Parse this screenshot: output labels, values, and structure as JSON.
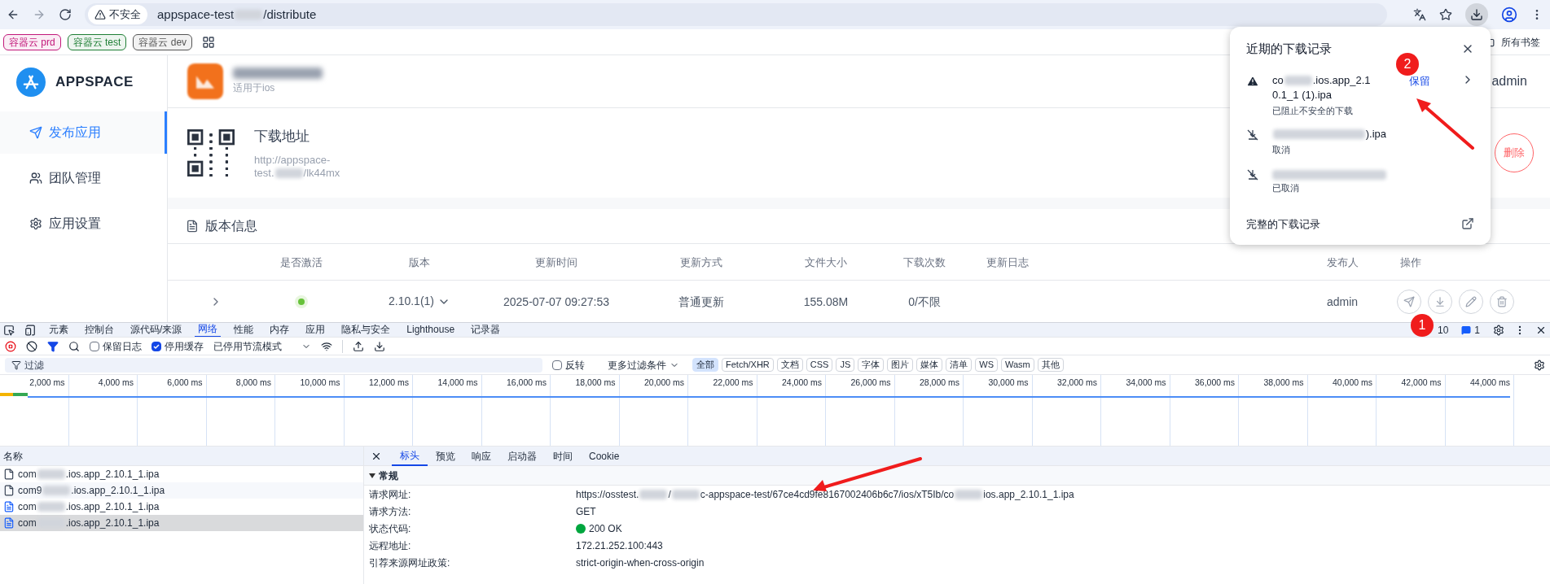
{
  "browser": {
    "security": "不安全",
    "url": [
      "appspace-test",
      "/distribute"
    ]
  },
  "bookmarks": [
    {
      "label": "容器云 prd",
      "color": "#c2187a"
    },
    {
      "label": "容器云 test",
      "color": "#1e7e34"
    },
    {
      "label": "容器云 dev",
      "color": "#555555"
    }
  ],
  "all_bookmarks": "所有书签",
  "sidebar": {
    "logo": "APPSPACE",
    "items": [
      {
        "label": "发布应用",
        "selected": true
      },
      {
        "label": "团队管理",
        "selected": false
      },
      {
        "label": "应用设置",
        "selected": false
      }
    ]
  },
  "app_header": {
    "platform": "适用于ios",
    "user": "admin"
  },
  "download": {
    "title": "下载地址",
    "url_line1": "http://appspace-",
    "url_line2": [
      "test.",
      "/lk44mx"
    ],
    "delete": "删除"
  },
  "versions": {
    "title": "版本信息",
    "columns": [
      "是否激活",
      "版本",
      "更新时间",
      "更新方式",
      "文件大小",
      "下载次数",
      "更新日志",
      "发布人",
      "操作"
    ],
    "rows": [
      {
        "active": true,
        "version": "2.10.1(1)",
        "time": "2025-07-07 09:27:53",
        "method": "普通更新",
        "size": "155.08M",
        "downloads": "0/不限",
        "publisher": "admin"
      }
    ]
  },
  "downloads_popup": {
    "title": "近期的下载记录",
    "items": [
      {
        "kind": "blocked",
        "name": [
          "co",
          ".ios.app_2.1",
          "0.1_1 (1).ipa"
        ],
        "status": "已阻止不安全的下载",
        "action": "保留"
      },
      {
        "kind": "cancelled",
        "redacted_start": true,
        "name": [
          ").ipa"
        ],
        "status": "取消"
      },
      {
        "kind": "cancelled",
        "status": "已取消"
      }
    ],
    "footer": "完整的下载记录"
  },
  "annotations": [
    {
      "label": "1"
    },
    {
      "label": "2"
    }
  ],
  "devtools": {
    "tabs": [
      {
        "label": "元素",
        "selected": false
      },
      {
        "label": "控制台",
        "selected": false
      },
      {
        "label": "源代码/来源",
        "selected": false
      },
      {
        "label": "网络",
        "selected": true
      },
      {
        "label": "性能",
        "selected": false
      },
      {
        "label": "内存",
        "selected": false
      },
      {
        "label": "应用",
        "selected": false
      },
      {
        "label": "隐私与安全",
        "selected": false
      },
      {
        "label": "Lighthouse",
        "selected": false
      },
      {
        "label": "记录器",
        "selected": false
      }
    ],
    "errors": "10",
    "messages": "1",
    "options": [
      {
        "label": "保留日志",
        "checked": false
      },
      {
        "label": "停用缓存",
        "checked": true
      }
    ],
    "throttling": "已停用节流模式",
    "filter_placeholder": "过滤",
    "invert": {
      "label": "反转",
      "checked": false
    },
    "more_filters": "更多过滤条件",
    "chips": [
      {
        "label": "全部",
        "selected": true
      },
      {
        "label": "Fetch/XHR",
        "selected": false
      },
      {
        "label": "文档",
        "selected": false
      },
      {
        "label": "CSS",
        "selected": false
      },
      {
        "label": "JS",
        "selected": false
      },
      {
        "label": "字体",
        "selected": false
      },
      {
        "label": "图片",
        "selected": false
      },
      {
        "label": "媒体",
        "selected": false
      },
      {
        "label": "清单",
        "selected": false
      },
      {
        "label": "WS",
        "selected": false
      },
      {
        "label": "Wasm",
        "selected": false
      },
      {
        "label": "其他",
        "selected": false
      }
    ],
    "ticks": [
      "2,000 ms",
      "4,000 ms",
      "6,000 ms",
      "8,000 ms",
      "10,000 ms",
      "12,000 ms",
      "14,000 ms",
      "16,000 ms",
      "18,000 ms",
      "20,000 ms",
      "22,000 ms",
      "24,000 ms",
      "26,000 ms",
      "28,000 ms",
      "30,000 ms",
      "32,000 ms",
      "34,000 ms",
      "36,000 ms",
      "38,000 ms",
      "40,000 ms",
      "42,000 ms",
      "44,000 ms"
    ],
    "list_header": "名称",
    "requests": [
      {
        "kind": "file",
        "name": [
          "com",
          ".ios.app_2.10.1_1.ipa"
        ],
        "selected": false
      },
      {
        "kind": "file",
        "name": [
          "com9",
          ".ios.app_2.10.1_1.ipa"
        ],
        "selected": false
      },
      {
        "kind": "document",
        "name": [
          "com",
          ".ios.app_2.10.1_1.ipa"
        ],
        "selected": false
      },
      {
        "kind": "document",
        "name": [
          "com",
          ".ios.app_2.10.1_1.ipa"
        ],
        "selected": true
      }
    ],
    "detail_tabs": [
      {
        "label": "标头",
        "selected": true
      },
      {
        "label": "预览",
        "selected": false
      },
      {
        "label": "响应",
        "selected": false
      },
      {
        "label": "启动器",
        "selected": false
      },
      {
        "label": "时间",
        "selected": false
      },
      {
        "label": "Cookie",
        "selected": false
      }
    ],
    "section": "常规",
    "general": [
      {
        "label": "请求网址:",
        "value": [
          "https://osstest.",
          "/",
          "c-appspace-test/67ce4cd9fe8167002406b6c7/ios/xT5Ib/co",
          "ios.app_2.10.1_1.ipa"
        ]
      },
      {
        "label": "请求方法:",
        "value": [
          "GET"
        ]
      },
      {
        "label": "状态代码:",
        "value": [
          "200 OK"
        ],
        "kind": "status"
      },
      {
        "label": "远程地址:",
        "value": [
          "172.21.252.100:443"
        ]
      },
      {
        "label": "引荐来源网址政策:",
        "value": [
          "strict-origin-when-cross-origin"
        ]
      }
    ]
  }
}
